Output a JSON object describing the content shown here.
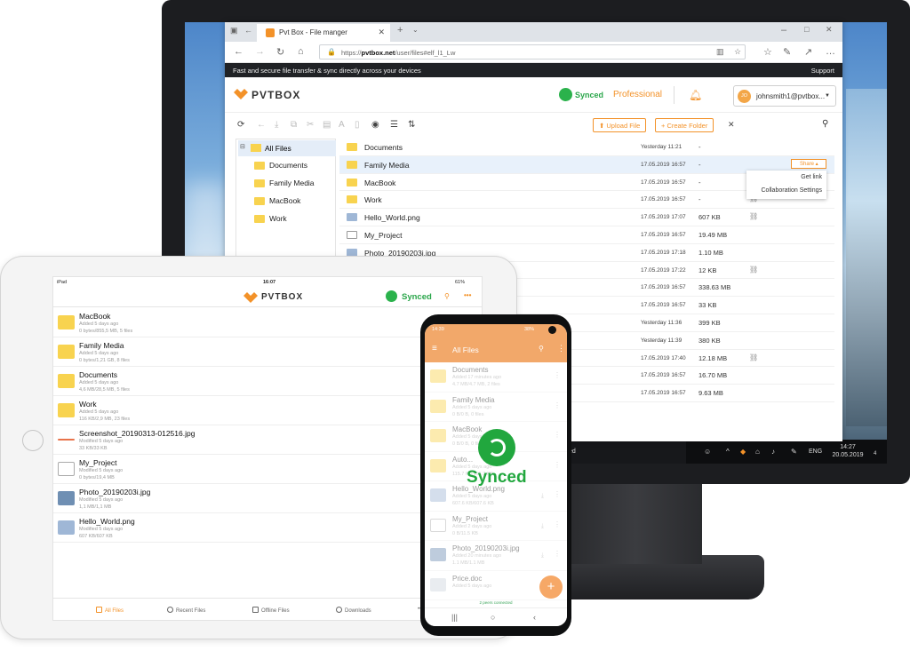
{
  "desktop": {
    "tab_title": "Pvt Box - File manger",
    "url_prefix": "https://",
    "url_domain": "pvtbox.net",
    "url_path": "/user/files#elf_l1_Lw",
    "banner_text": "Fast and secure file transfer & sync directly across your devices",
    "support_label": "Support",
    "logo_text": "PVTBOX",
    "synced_label": "Synced",
    "plan_label": "Professional",
    "user_initials": "JO",
    "user_email": "johnsmith1@pvtbox...",
    "upload_label": "Upload File",
    "create_folder_label": "Create Folder",
    "tree": {
      "root": "All Files",
      "items": [
        "Documents",
        "Family Media",
        "MacBook",
        "Work"
      ]
    },
    "files": [
      {
        "name": "Documents",
        "date": "Yesterday 11:21",
        "size": "-",
        "icon": "folder"
      },
      {
        "name": "Family Media",
        "date": "17.05.2019 16:57",
        "size": "-",
        "icon": "shared-folder"
      },
      {
        "name": "MacBook",
        "date": "17.05.2019 16:57",
        "size": "-",
        "icon": "folder"
      },
      {
        "name": "Work",
        "date": "17.05.2019 16:57",
        "size": "-",
        "icon": "shared-folder"
      },
      {
        "name": "Hello_World.png",
        "date": "17.05.2019 17:07",
        "size": "607 KB",
        "icon": "image"
      },
      {
        "name": "My_Project",
        "date": "17.05.2019 16:57",
        "size": "19.49 MB",
        "icon": "file"
      },
      {
        "name": "Photo_20190203i.jpg",
        "date": "17.05.2019 17:18",
        "size": "1.10 MB",
        "icon": "image"
      },
      {
        "name": "",
        "date": "17.05.2019 17:22",
        "size": "12 KB",
        "icon": ""
      },
      {
        "name": "",
        "date": "17.05.2019 16:57",
        "size": "338.63 MB",
        "icon": ""
      },
      {
        "name": "",
        "date": "17.05.2019 16:57",
        "size": "33 KB",
        "icon": ""
      },
      {
        "name": "",
        "date": "Yesterday 11:36",
        "size": "399 KB",
        "icon": ""
      },
      {
        "name": "",
        "date": "Yesterday 11:39",
        "size": "380 KB",
        "icon": ""
      },
      {
        "name": "",
        "date": "17.05.2019 17:40",
        "size": "12.18 MB",
        "icon": ""
      },
      {
        "name": "",
        "date": "17.05.2019 16:57",
        "size": "16.70 MB",
        "icon": ""
      },
      {
        "name": "",
        "date": "17.05.2019 16:57",
        "size": "9.63 MB",
        "icon": ""
      }
    ],
    "share_label": "Share",
    "share_menu": [
      "Get link",
      "Collaboration Settings"
    ],
    "taskbar": {
      "fragment": "ed",
      "arrows": "<<<",
      "t_icon": "t",
      "lang_short": "EN",
      "lang": "ENG",
      "time": "14:27",
      "date": "20.05.2019",
      "notif_count": "4"
    }
  },
  "tablet": {
    "carrier": "iPad",
    "clock": "16:07",
    "battery": "61%",
    "logo_text": "PVTBOX",
    "synced_label": "Synced",
    "files": [
      {
        "name": "MacBook",
        "meta1": "Added  5 days  ago",
        "meta2": "0 bytes/855,5 MB, 5 files",
        "icon": "folder"
      },
      {
        "name": "Family Media",
        "meta1": "Added  5 days  ago",
        "meta2": "0 bytes/1,21 GB, 8 files",
        "icon": "shared-folder"
      },
      {
        "name": "Documents",
        "meta1": "Added  5 days  ago",
        "meta2": "4,6 MB/28,5 MB, 5 files",
        "icon": "folder"
      },
      {
        "name": "Work",
        "meta1": "Added  5 days  ago",
        "meta2": "116 KB/2,9 MB, 23 files",
        "icon": "shared-folder"
      },
      {
        "name": "Screenshot_20190313-012516.jpg",
        "meta1": "Modified  5 days  ago",
        "meta2": "33 KB/33 KB",
        "icon": "line"
      },
      {
        "name": "My_Project",
        "meta1": "Modified  5 days  ago",
        "meta2": "0 bytes/19,4 MB",
        "icon": "file"
      },
      {
        "name": "Photo_20190203i.jpg",
        "meta1": "Modified  5 days  ago",
        "meta2": "1,1 MB/1,1 MB",
        "icon": "photo"
      },
      {
        "name": "Hello_World.png",
        "meta1": "Modified  5 days  ago",
        "meta2": "607 KB/607 KB",
        "icon": "image"
      }
    ],
    "nav": [
      "All Files",
      "Recent Files",
      "Offline Files",
      "Downloads"
    ]
  },
  "phone": {
    "time": "14:39",
    "battery": "38%",
    "title": "All Files",
    "files": [
      {
        "name": "Documents",
        "meta1": "Added 17 minutes ago",
        "meta2": "4.7 MB/4.7 MB, 2 files",
        "icon": "folder"
      },
      {
        "name": "Family Media",
        "meta1": "Added 5 days ago",
        "meta2": "0 B/0 B, 0 files",
        "icon": "shared-folder"
      },
      {
        "name": "MacBook",
        "meta1": "Added 5 days ago",
        "meta2": "0 B/0 B, 0 files",
        "icon": "folder"
      },
      {
        "name": "Auto...",
        "meta1": "Added 5 days ago",
        "meta2": "115.7 KB/115.7 KB",
        "icon": "shared-folder"
      },
      {
        "name": "Hello_World.png",
        "meta1": "Added 5 days ago",
        "meta2": "607.6 KB/607.6 KB",
        "icon": "image"
      },
      {
        "name": "My_Project",
        "meta1": "Added 2 days ago",
        "meta2": "0 B/11.5 KB",
        "icon": "file"
      },
      {
        "name": "Photo_20190203i.jpg",
        "meta1": "Added 20 minutes ago",
        "meta2": "1.1 MB/1.1 MB",
        "icon": "photo"
      },
      {
        "name": "Price.doc",
        "meta1": "Added 5 days ago",
        "meta2": "",
        "icon": "doc"
      }
    ],
    "synced_label": "Synced",
    "footer_text": "2 peers connected"
  },
  "colors": {
    "accent": "#f39229",
    "synced": "#2aa64a",
    "folder": "#f8d34f"
  }
}
